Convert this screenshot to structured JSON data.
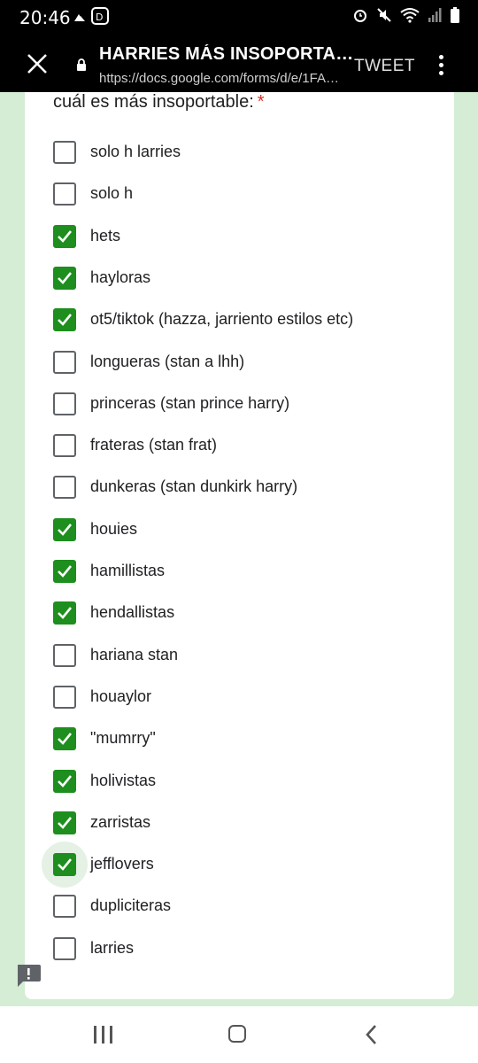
{
  "status_bar": {
    "time": "20:46",
    "left_icons": [
      "cloud-icon",
      "disney-plus-icon"
    ],
    "right_icons": [
      "alarm-icon",
      "mute-icon",
      "wifi-icon",
      "signal-icon",
      "battery-icon"
    ]
  },
  "app_bar": {
    "title": "HARRIES MÁS INSOPORTABL…",
    "url": "https://docs.google.com/forms/d/e/1FA…",
    "tweet_label": "TWEET"
  },
  "form": {
    "question": "cuál es más insoportable:",
    "required_mark": "*",
    "options": [
      {
        "label": "solo h larries",
        "checked": false
      },
      {
        "label": "solo h",
        "checked": false
      },
      {
        "label": "hets",
        "checked": true
      },
      {
        "label": "hayloras",
        "checked": true
      },
      {
        "label": "ot5/tiktok (hazza, jarriento estilos etc)",
        "checked": true
      },
      {
        "label": "longueras (stan a lhh)",
        "checked": false
      },
      {
        "label": "princeras (stan prince harry)",
        "checked": false
      },
      {
        "label": "frateras (stan frat)",
        "checked": false
      },
      {
        "label": "dunkeras (stan dunkirk harry)",
        "checked": false
      },
      {
        "label": "houies",
        "checked": true
      },
      {
        "label": "hamillistas",
        "checked": true
      },
      {
        "label": "hendallistas",
        "checked": true
      },
      {
        "label": "hariana stan",
        "checked": false
      },
      {
        "label": "houaylor",
        "checked": false
      },
      {
        "label": "\"mumrry\"",
        "checked": true
      },
      {
        "label": "holivistas",
        "checked": true
      },
      {
        "label": "zarristas",
        "checked": true
      },
      {
        "label": "jefflovers",
        "checked": true,
        "focused": true
      },
      {
        "label": "dupliciteras",
        "checked": false
      },
      {
        "label": "larries",
        "checked": false
      }
    ]
  },
  "colors": {
    "page_background": "#d4edd4",
    "checkbox_checked": "#1e8e1e",
    "required": "#d93025",
    "app_bar": "#000000"
  }
}
